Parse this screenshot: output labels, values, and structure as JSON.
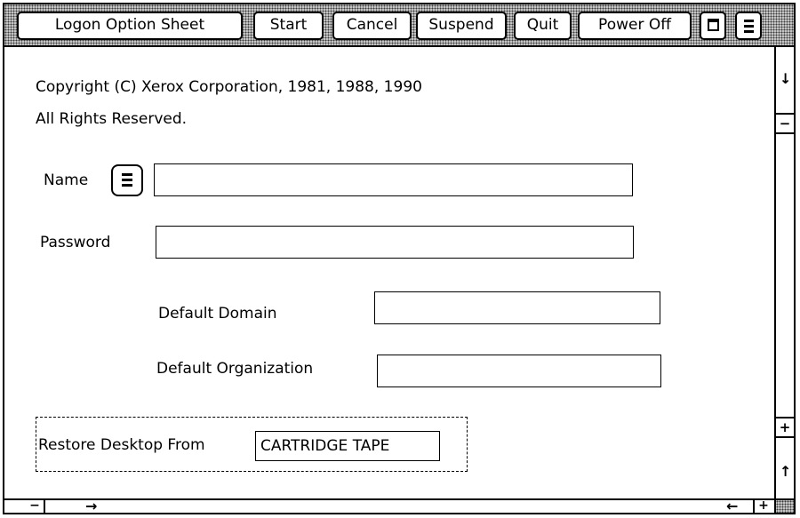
{
  "titlebar": {
    "buttons": {
      "logon_option_sheet": "Logon Option Sheet",
      "start": "Start",
      "cancel": "Cancel",
      "suspend": "Suspend",
      "quit": "Quit",
      "power_off": "Power Off"
    },
    "icons": [
      "window-icon",
      "menu-icon"
    ]
  },
  "copyright": {
    "line1": "Copyright (C) Xerox Corporation, 1981, 1988, 1990",
    "line2": "All Rights Reserved."
  },
  "form": {
    "name_label": "Name",
    "name_value": "",
    "password_label": "Password",
    "password_value": "",
    "default_domain_label": "Default Domain",
    "default_domain_value": "",
    "default_organization_label": "Default Organization",
    "default_organization_value": "",
    "restore_label": "Restore Desktop From",
    "restore_value": "CARTRIDGE TAPE"
  },
  "scrollbars": {
    "vertical": {
      "top": "↓",
      "minus": "−",
      "plus": "+",
      "bottom": "↑"
    },
    "horizontal": {
      "minus": "−",
      "right_arrow": "→",
      "left_arrow": "←",
      "plus": "+"
    }
  },
  "colors": {
    "background": "#ffffff",
    "foreground": "#000000",
    "pattern": "#c8c8c8"
  }
}
